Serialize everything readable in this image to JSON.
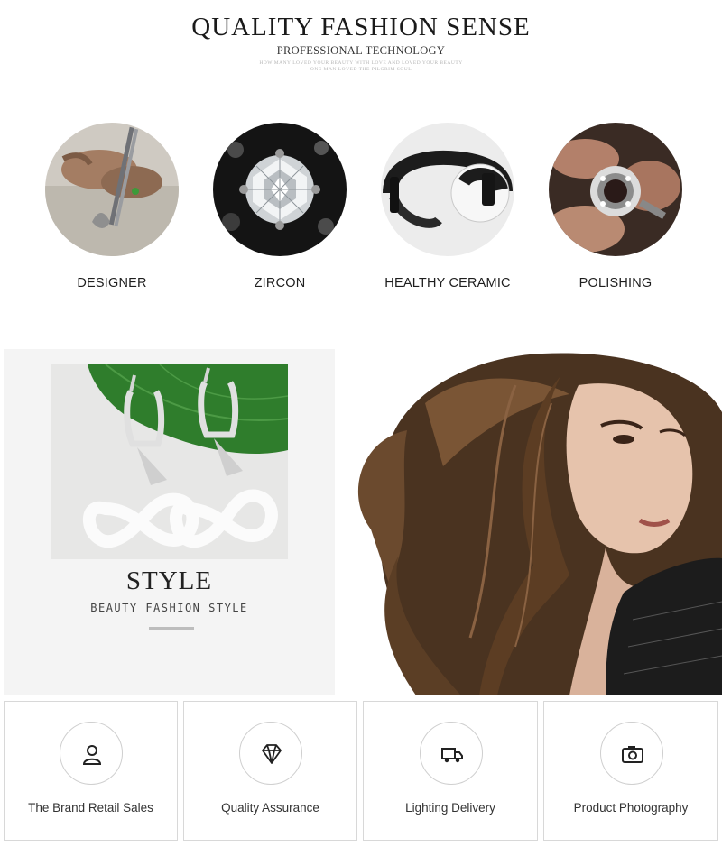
{
  "header": {
    "title": "QUALITY FASHION SENSE",
    "subtitle": "PROFESSIONAL TECHNOLOGY",
    "small_line_1": "HOW MANY LOVED YOUR BEAUTY WITH LOVE AND LOVED YOUR BEAUTY",
    "small_line_2": "ONE MAN LOVED THE PILGRIM SOUL"
  },
  "features": [
    {
      "label": "DESIGNER",
      "icon": "designer-image"
    },
    {
      "label": "ZIRCON",
      "icon": "zircon-image"
    },
    {
      "label": "HEALTHY CERAMIC",
      "icon": "ceramic-ring-image"
    },
    {
      "label": "POLISHING",
      "icon": "polishing-image"
    }
  ],
  "banner": {
    "style_title": "STYLE",
    "style_subtitle": "BEAUTY FASHION STYLE"
  },
  "services": [
    {
      "label": "The Brand Retail Sales",
      "icon": "user-icon"
    },
    {
      "label": "Quality Assurance",
      "icon": "diamond-icon"
    },
    {
      "label": "Lighting Delivery",
      "icon": "truck-icon"
    },
    {
      "label": "Product Photography",
      "icon": "camera-icon"
    }
  ]
}
